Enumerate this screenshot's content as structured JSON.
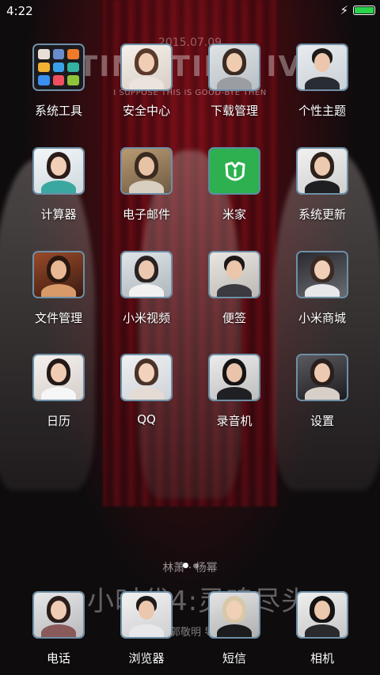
{
  "status_bar": {
    "time": "4:22",
    "battery_color": "#2bd34a"
  },
  "wallpaper": {
    "date": "2015.07.09",
    "title": "TINY TIME IV",
    "subtitle": "I SUPPOSE THIS IS GOOD-BYE THEN",
    "cast": "林萧 · 杨幂",
    "movie": "小时代4:灵魂尽头",
    "director": "郭敬明 导演"
  },
  "apps": [
    {
      "label": "系统工具",
      "icon": "folder-icon"
    },
    {
      "label": "安全中心",
      "icon": "security-center-icon"
    },
    {
      "label": "下载管理",
      "icon": "download-manager-icon"
    },
    {
      "label": "个性主题",
      "icon": "themes-icon"
    },
    {
      "label": "计算器",
      "icon": "calculator-icon"
    },
    {
      "label": "电子邮件",
      "icon": "email-icon"
    },
    {
      "label": "米家",
      "icon": "mijia-icon"
    },
    {
      "label": "系统更新",
      "icon": "system-update-icon"
    },
    {
      "label": "文件管理",
      "icon": "file-manager-icon"
    },
    {
      "label": "小米视频",
      "icon": "mi-video-icon"
    },
    {
      "label": "便签",
      "icon": "notes-icon"
    },
    {
      "label": "小米商城",
      "icon": "mi-store-icon"
    },
    {
      "label": "日历",
      "icon": "calendar-icon"
    },
    {
      "label": "QQ",
      "icon": "qq-icon"
    },
    {
      "label": "录音机",
      "icon": "recorder-icon"
    },
    {
      "label": "设置",
      "icon": "settings-icon"
    }
  ],
  "dock": [
    {
      "label": "电话",
      "icon": "phone-icon"
    },
    {
      "label": "浏览器",
      "icon": "browser-icon"
    },
    {
      "label": "短信",
      "icon": "messages-icon"
    },
    {
      "label": "相机",
      "icon": "camera-icon"
    }
  ],
  "page_indicator": {
    "count": 2,
    "active": 1
  }
}
